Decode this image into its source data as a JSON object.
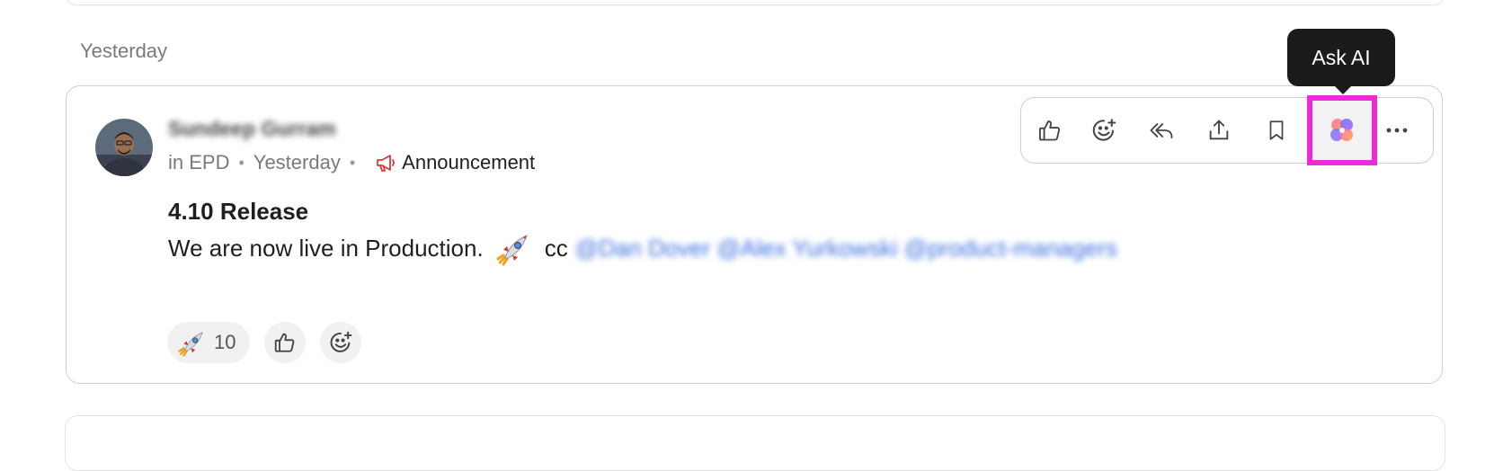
{
  "feed": {
    "day_label": "Yesterday"
  },
  "post": {
    "author": "Sundeep Gurram",
    "channel": "in EPD",
    "separator": "•",
    "time": "Yesterday",
    "tag": "Announcement",
    "title": "4.10 Release",
    "body_text": "We are now live in Production.",
    "cc_label": "cc",
    "mentions": "@Dan Dover @Alex Yurkowski  @product-managers",
    "reactions": [
      {
        "icon": "rocket-emoji",
        "count": "10"
      },
      {
        "icon": "thumbs-up-icon"
      },
      {
        "icon": "add-reaction-icon"
      }
    ]
  },
  "toolbar": {
    "items": [
      "like",
      "add-reaction",
      "reply",
      "share",
      "bookmark",
      "ask-ai",
      "more"
    ]
  },
  "tooltip": {
    "label": "Ask AI"
  },
  "colors": {
    "highlight": "#ee2ad8",
    "mention": "#3d6fe0",
    "announcement_icon": "#d93a3a"
  }
}
